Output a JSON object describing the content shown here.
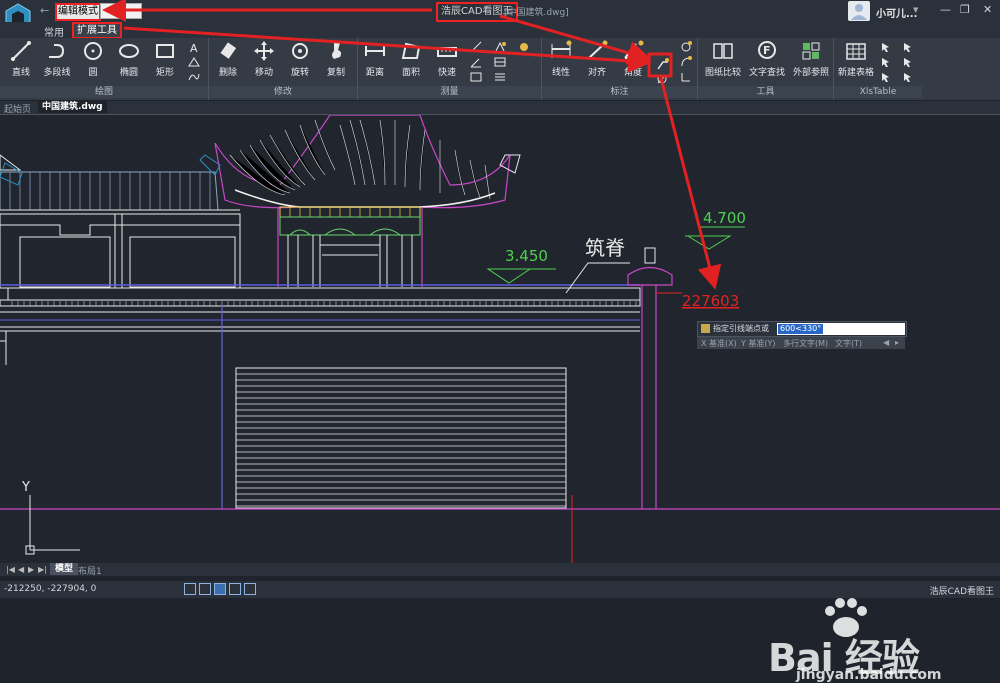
{
  "titlebar": {
    "mode": "编辑模式",
    "app_title": "浩辰CAD看图王",
    "file_title": "[中国建筑.dwg]",
    "user_name": "小可儿...",
    "minimize": "—",
    "restore": "❐",
    "close": "✕"
  },
  "menu": {
    "tab_common": "常用",
    "tab_extended": "扩展工具"
  },
  "ribbon": {
    "groups": {
      "draw": "绘图",
      "modify": "修改",
      "measure": "测量",
      "annotate": "标注",
      "tools": "工具",
      "xlstable": "XlsTable"
    },
    "draw_tools": [
      "直线",
      "多段线",
      "圆",
      "椭圆",
      "矩形"
    ],
    "modify_tools": [
      "删除",
      "移动",
      "旋转",
      "复制"
    ],
    "measure_tools": [
      "距离",
      "面积",
      "快速"
    ],
    "annotate_tools": [
      "线性",
      "对齐",
      "角度"
    ],
    "tool_tools": [
      "图纸比较",
      "文字查找",
      "外部参照"
    ],
    "xls_tools": [
      "新建表格"
    ]
  },
  "doc_tabs": {
    "start": "起始页",
    "file": "中国建筑.dwg"
  },
  "drawing": {
    "label_ridge": "筑脊",
    "elev_1": "3.450",
    "elev_2": "4.700",
    "red_dim": "227603",
    "axis_y": "Y"
  },
  "command": {
    "prompt": "指定引线端点或",
    "input_value": "600<330°",
    "options": [
      "X 基准(X)",
      "Y 基准(Y)",
      "多行文字(M)",
      "文字(T)"
    ]
  },
  "layout_tabs": {
    "model": "模型",
    "layout1": "布局1"
  },
  "status": {
    "coords": "-212250, -227904, 0",
    "app_name": "浩辰CAD看图王"
  },
  "watermark": {
    "text": "Bai  经验",
    "url": "jingyan.baidu.com"
  },
  "colors": {
    "accent_red": "#e22222",
    "canvas_bg": "#21262e",
    "ribbon_bg": "#343b45"
  }
}
